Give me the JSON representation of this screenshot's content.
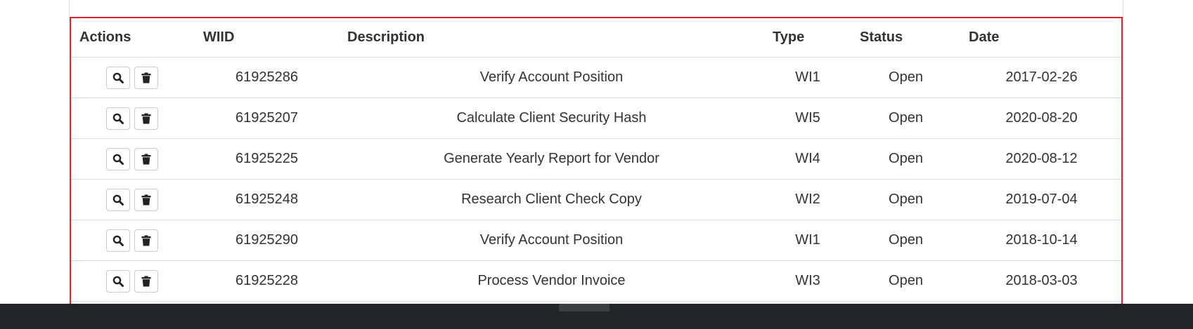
{
  "table": {
    "headers": {
      "actions": "Actions",
      "wiid": "WIID",
      "description": "Description",
      "type": "Type",
      "status": "Status",
      "date": "Date"
    },
    "rows": [
      {
        "wiid": "61925286",
        "description": "Verify Account Position",
        "type": "WI1",
        "status": "Open",
        "date": "2017-02-26"
      },
      {
        "wiid": "61925207",
        "description": "Calculate Client Security Hash",
        "type": "WI5",
        "status": "Open",
        "date": "2020-08-20"
      },
      {
        "wiid": "61925225",
        "description": "Generate Yearly Report for Vendor",
        "type": "WI4",
        "status": "Open",
        "date": "2020-08-12"
      },
      {
        "wiid": "61925248",
        "description": "Research Client Check Copy",
        "type": "WI2",
        "status": "Open",
        "date": "2019-07-04"
      },
      {
        "wiid": "61925290",
        "description": "Verify Account Position",
        "type": "WI1",
        "status": "Open",
        "date": "2018-10-14"
      },
      {
        "wiid": "61925228",
        "description": "Process Vendor Invoice",
        "type": "WI3",
        "status": "Open",
        "date": "2018-03-03"
      }
    ],
    "row_actions": [
      "search-icon",
      "trash-icon"
    ]
  },
  "colors": {
    "highlight_border": "#e0242b",
    "bottom_bar": "#212529",
    "row_divider": "#dddddd"
  }
}
